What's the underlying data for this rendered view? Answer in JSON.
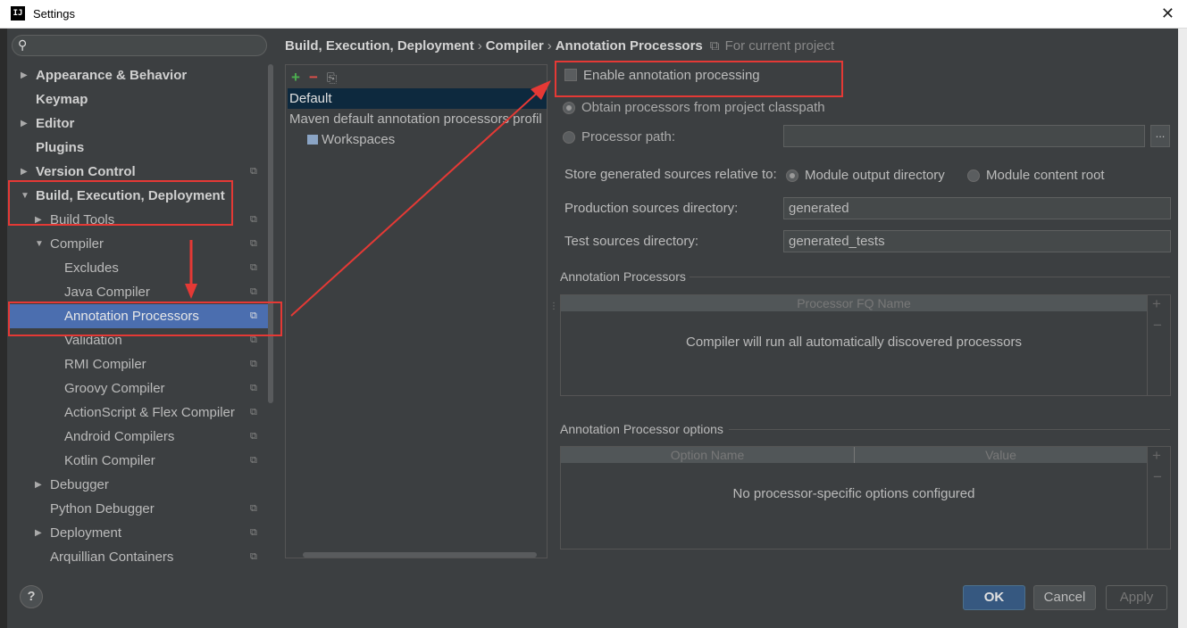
{
  "window": {
    "title": "Settings",
    "close_glyph": "✕",
    "app_icon_text": "IJ"
  },
  "search": {
    "placeholder": ""
  },
  "sidebar": {
    "items": [
      {
        "label": "Appearance & Behavior",
        "level": 0,
        "arrow": "right",
        "bold": true,
        "project": false
      },
      {
        "label": "Keymap",
        "level": 0,
        "arrow": "none",
        "bold": true,
        "project": false
      },
      {
        "label": "Editor",
        "level": 0,
        "arrow": "right",
        "bold": true,
        "project": false
      },
      {
        "label": "Plugins",
        "level": 0,
        "arrow": "none",
        "bold": true,
        "project": false
      },
      {
        "label": "Version Control",
        "level": 0,
        "arrow": "right",
        "bold": true,
        "project": true
      },
      {
        "label": "Build, Execution, Deployment",
        "level": 0,
        "arrow": "down",
        "bold": true,
        "project": false
      },
      {
        "label": "Build Tools",
        "level": 1,
        "arrow": "right",
        "bold": false,
        "project": true
      },
      {
        "label": "Compiler",
        "level": 1,
        "arrow": "down",
        "bold": false,
        "project": true
      },
      {
        "label": "Excludes",
        "level": 2,
        "arrow": "none",
        "bold": false,
        "project": true
      },
      {
        "label": "Java Compiler",
        "level": 2,
        "arrow": "none",
        "bold": false,
        "project": true
      },
      {
        "label": "Annotation Processors",
        "level": 2,
        "arrow": "none",
        "bold": false,
        "project": true,
        "selected": true
      },
      {
        "label": "Validation",
        "level": 2,
        "arrow": "none",
        "bold": false,
        "project": true
      },
      {
        "label": "RMI Compiler",
        "level": 2,
        "arrow": "none",
        "bold": false,
        "project": true
      },
      {
        "label": "Groovy Compiler",
        "level": 2,
        "arrow": "none",
        "bold": false,
        "project": true
      },
      {
        "label": "ActionScript & Flex Compiler",
        "level": 2,
        "arrow": "none",
        "bold": false,
        "project": true
      },
      {
        "label": "Android Compilers",
        "level": 2,
        "arrow": "none",
        "bold": false,
        "project": true
      },
      {
        "label": "Kotlin Compiler",
        "level": 2,
        "arrow": "none",
        "bold": false,
        "project": true
      },
      {
        "label": "Debugger",
        "level": 1,
        "arrow": "right",
        "bold": false,
        "project": false
      },
      {
        "label": "Python Debugger",
        "level": 1,
        "arrow": "none",
        "bold": false,
        "project": true
      },
      {
        "label": "Deployment",
        "level": 1,
        "arrow": "right",
        "bold": false,
        "project": true
      },
      {
        "label": "Arquillian Containers",
        "level": 1,
        "arrow": "none",
        "bold": false,
        "project": true
      }
    ]
  },
  "breadcrumb": {
    "parts": [
      "Build, Execution, Deployment",
      "Compiler",
      "Annotation Processors"
    ],
    "separator": "›",
    "project_note": "For current project"
  },
  "profiles": {
    "toolbar": {
      "add": "+",
      "remove": "−",
      "move": "⎘"
    },
    "items": [
      {
        "label": "Default",
        "selected": true
      },
      {
        "label": "Maven default annotation processors profil",
        "selected": false
      },
      {
        "label": "Workspaces",
        "selected": false
      }
    ]
  },
  "form": {
    "enable_label": "Enable annotation processing",
    "enable_checked": false,
    "obtain_label": "Obtain processors from project classpath",
    "processor_path_label": "Processor path:",
    "processor_path_value": "",
    "browse": "...",
    "store_label": "Store generated sources relative to:",
    "module_output": "Module output directory",
    "module_content": "Module content root",
    "prod_label": "Production sources directory:",
    "prod_value": "generated",
    "test_label": "Test sources directory:",
    "test_value": "generated_tests"
  },
  "processors_group": {
    "title": "Annotation Processors",
    "column": "Processor FQ Name",
    "empty": "Compiler will run all automatically discovered processors"
  },
  "options_group": {
    "title": "Annotation Processor options",
    "columns": [
      "Option Name",
      "Value"
    ],
    "empty": "No processor-specific options configured"
  },
  "buttons": {
    "ok": "OK",
    "cancel": "Cancel",
    "apply": "Apply",
    "help": "?"
  },
  "colors": {
    "accent": "#4b6eaf",
    "annotation_red": "#e53935",
    "background": "#3c3f41"
  }
}
